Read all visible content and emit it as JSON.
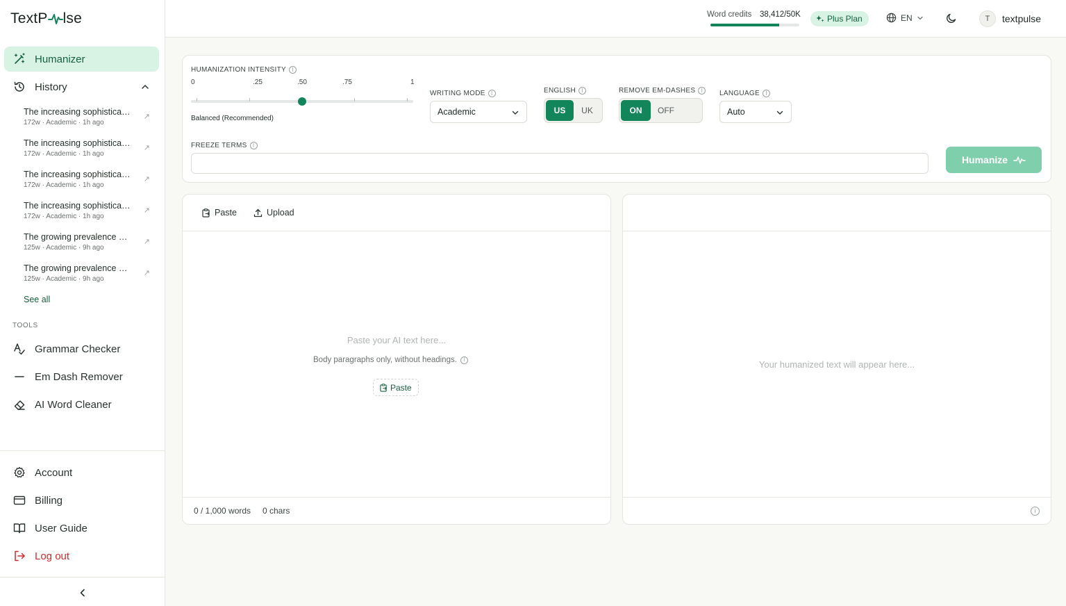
{
  "app": {
    "logo_prefix": "TextP",
    "logo_suffix": "lse"
  },
  "sidebar": {
    "humanizer": "Humanizer",
    "history": "History",
    "history_items": [
      {
        "title": "The increasing sophisticati…",
        "meta": "172w · Academic · 1h ago"
      },
      {
        "title": "The increasing sophisticati…",
        "meta": "172w · Academic · 1h ago"
      },
      {
        "title": "The increasing sophisticati…",
        "meta": "172w · Academic · 1h ago"
      },
      {
        "title": "The increasing sophisticati…",
        "meta": "172w · Academic · 1h ago"
      },
      {
        "title": "The growing prevalence of …",
        "meta": "125w · Academic · 9h ago"
      },
      {
        "title": "The growing prevalence of …",
        "meta": "125w · Academic · 9h ago"
      }
    ],
    "see_all": "See all",
    "tools_label": "TOOLS",
    "tools": [
      "Grammar Checker",
      "Em Dash Remover",
      "AI Word Cleaner"
    ],
    "account": "Account",
    "billing": "Billing",
    "user_guide": "User Guide",
    "logout": "Log out"
  },
  "topbar": {
    "credits_label": "Word credits",
    "credits_value": "38,412/50K",
    "credits_fraction": 0.77,
    "plan": "Plus Plan",
    "language": "EN",
    "username": "textpulse",
    "avatar_initial": "T"
  },
  "settings": {
    "intensity_label": "HUMANIZATION INTENSITY",
    "ticks": [
      "0",
      ".25",
      ".50",
      ".75",
      "1"
    ],
    "intensity_value": 0.5,
    "intensity_caption": "Balanced (Recommended)",
    "writing_mode_label": "WRITING MODE",
    "writing_mode_value": "Academic",
    "english_label": "ENGLISH",
    "english_options": [
      "US",
      "UK"
    ],
    "english_selected": "US",
    "em_dash_label": "REMOVE EM-DASHES",
    "em_dash_options": [
      "ON",
      "OFF"
    ],
    "em_dash_selected": "ON",
    "language_label": "LANGUAGE",
    "language_value": "Auto",
    "freeze_label": "FREEZE TERMS",
    "freeze_value": "",
    "humanize_button": "Humanize"
  },
  "input_panel": {
    "paste": "Paste",
    "upload": "Upload",
    "placeholder": "Paste your AI text here...",
    "hint": "Body paragraphs only, without headings.",
    "paste_mini": "Paste",
    "word_count": "0 / 1,000 words",
    "char_count": "0 chars"
  },
  "output_panel": {
    "placeholder": "Your humanized text will appear here..."
  },
  "colors": {
    "accent": "#12855a",
    "accent_light": "#d8f3e4",
    "danger": "#d12a2a"
  }
}
